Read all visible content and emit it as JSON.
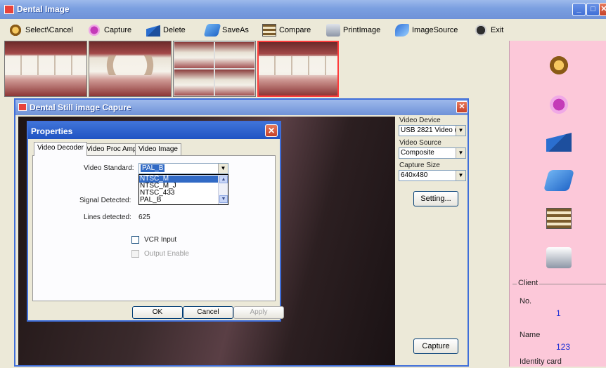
{
  "window": {
    "title": "Dental Image"
  },
  "toolbar": {
    "select_cancel": "Select\\Cancel",
    "capture": "Capture",
    "delete": "Delete",
    "save_as": "SaveAs",
    "compare": "Compare",
    "print_image": "PrintImage",
    "image_source": "ImageSource",
    "exit": "Exit"
  },
  "capture_dialog": {
    "title": "Dental  Still image Capure",
    "video_device_label": "Video Device",
    "video_device_value": "USB 2821 Video (W",
    "video_source_label": "Video Source",
    "video_source_value": "Composite",
    "capture_size_label": "Capture Size",
    "capture_size_value": "640x480",
    "setting_button": "Setting...",
    "capture_button": "Capture"
  },
  "properties_dialog": {
    "title": "Properties",
    "tabs": [
      "Video Decoder",
      "Video Proc Amp",
      "Video Image"
    ],
    "video_standard_label": "Video Standard:",
    "video_standard_value": "PAL_B",
    "video_standard_options": [
      "NTSC_M",
      "NTSC_M_J",
      "NTSC_433",
      "PAL_B"
    ],
    "signal_detected_label": "Signal Detected:",
    "lines_detected_label": "Lines detected:",
    "lines_detected_value": "625",
    "vcr_input_label": "VCR Input",
    "output_enable_label": "Output Enable",
    "ok_button": "OK",
    "cancel_button": "Cancel",
    "apply_button": "Apply"
  },
  "client_panel": {
    "legend": "Client",
    "no_label": "No.",
    "no_value": "1",
    "name_label": "Name",
    "name_value": "123",
    "identity_label": "Identity card"
  }
}
